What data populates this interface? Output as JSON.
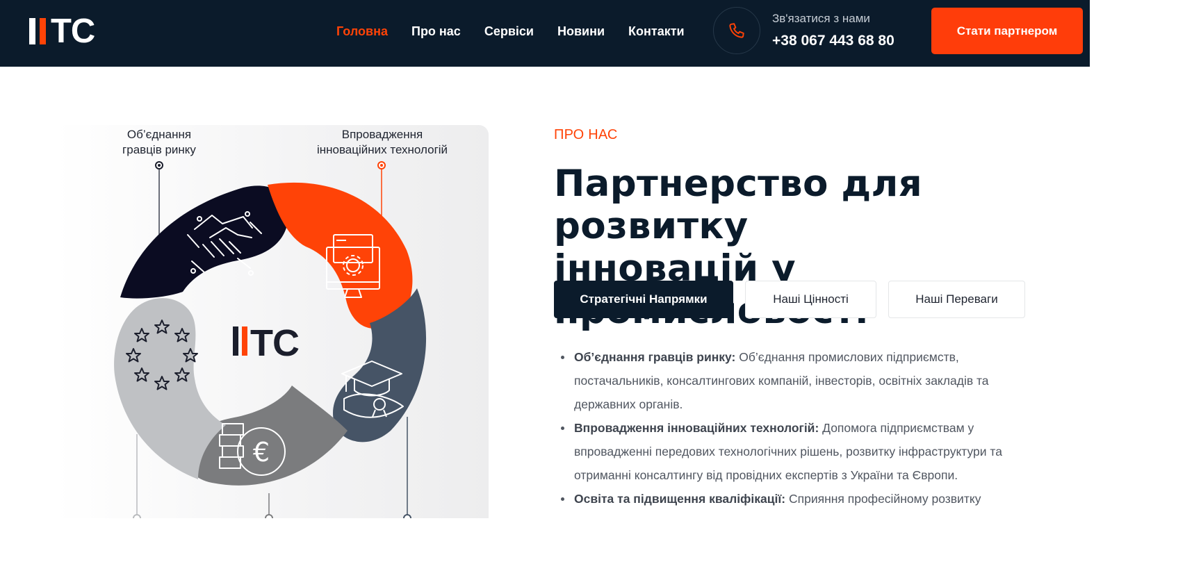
{
  "header": {
    "logo": "ITC",
    "nav": [
      {
        "label": "Головна",
        "active": true
      },
      {
        "label": "Про нас",
        "active": false
      },
      {
        "label": "Сервіси",
        "active": false
      },
      {
        "label": "Новини",
        "active": false
      },
      {
        "label": "Контакти",
        "active": false
      }
    ],
    "contact_label": "Зв'язатися з нами",
    "contact_phone": "+38 067 443 68 80",
    "cta_label": "Стати партнером",
    "phone_icon": "phone-icon"
  },
  "illustration": {
    "label_left_1": "Об’єднання",
    "label_left_2": "гравців ринку",
    "label_right_1": "Впровадження",
    "label_right_2": "інноваційних технологій",
    "center_logo": "ITC",
    "icons": [
      "handshake-icon",
      "computer-gear-icon",
      "graduation-cap-icon",
      "euro-coin-icon",
      "eu-stars-icon"
    ]
  },
  "about": {
    "eyebrow": "ПРО НАС",
    "title_line1": "Партнерство для розвитку",
    "title_line2": "інновацій у промисловості",
    "tabs": [
      {
        "label": "Стратегічні Напрямки",
        "active": true
      },
      {
        "label": "Наші Цінності",
        "active": false
      },
      {
        "label": "Наші Переваги",
        "active": false
      }
    ],
    "items": [
      {
        "title": "Об’єднання гравців ринку:",
        "text": " Об’єднання промислових підприємств, постачальників, консалтингових компаній, інвесторів, освітніх закладів та державних органів."
      },
      {
        "title": "Впровадження інноваційних технологій:",
        "text": " Допомога підприємствам у впровадженні передових технологічних рішень, розвитку інфраструктури та отриманні консалтингу від провідних експертів з України та Європи."
      },
      {
        "title": "Освіта та підвищення кваліфікації:",
        "text": " Сприяння професійному розвитку"
      }
    ]
  },
  "colors": {
    "navy": "#0b1b2b",
    "accent": "#ff4307",
    "slate": "#465466",
    "gray": "#7b7c7e",
    "lightgray": "#bfc1c4"
  }
}
